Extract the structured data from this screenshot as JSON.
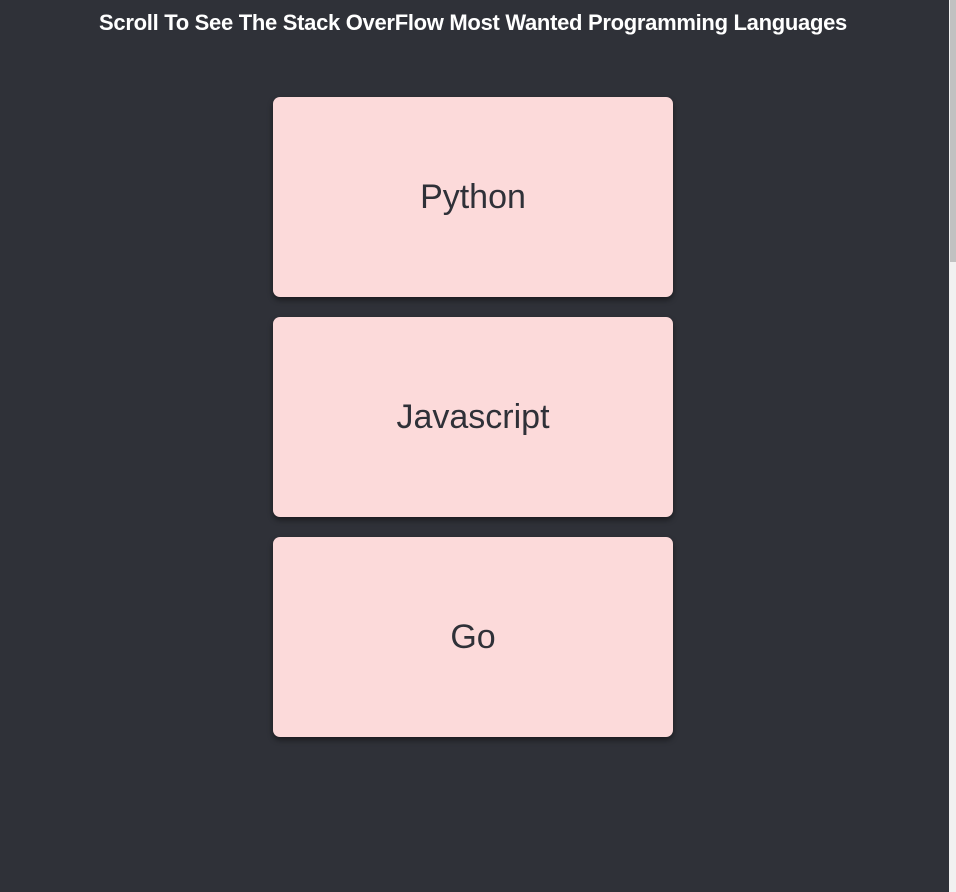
{
  "header": {
    "title": "Scroll To See The Stack OverFlow Most Wanted Programming Languages"
  },
  "cards": [
    {
      "label": "Python"
    },
    {
      "label": "Javascript"
    },
    {
      "label": "Go"
    }
  ],
  "colors": {
    "background": "#2f3138",
    "card": "#fcdada",
    "card_text": "#2f3138",
    "title_text": "#ffffff"
  }
}
